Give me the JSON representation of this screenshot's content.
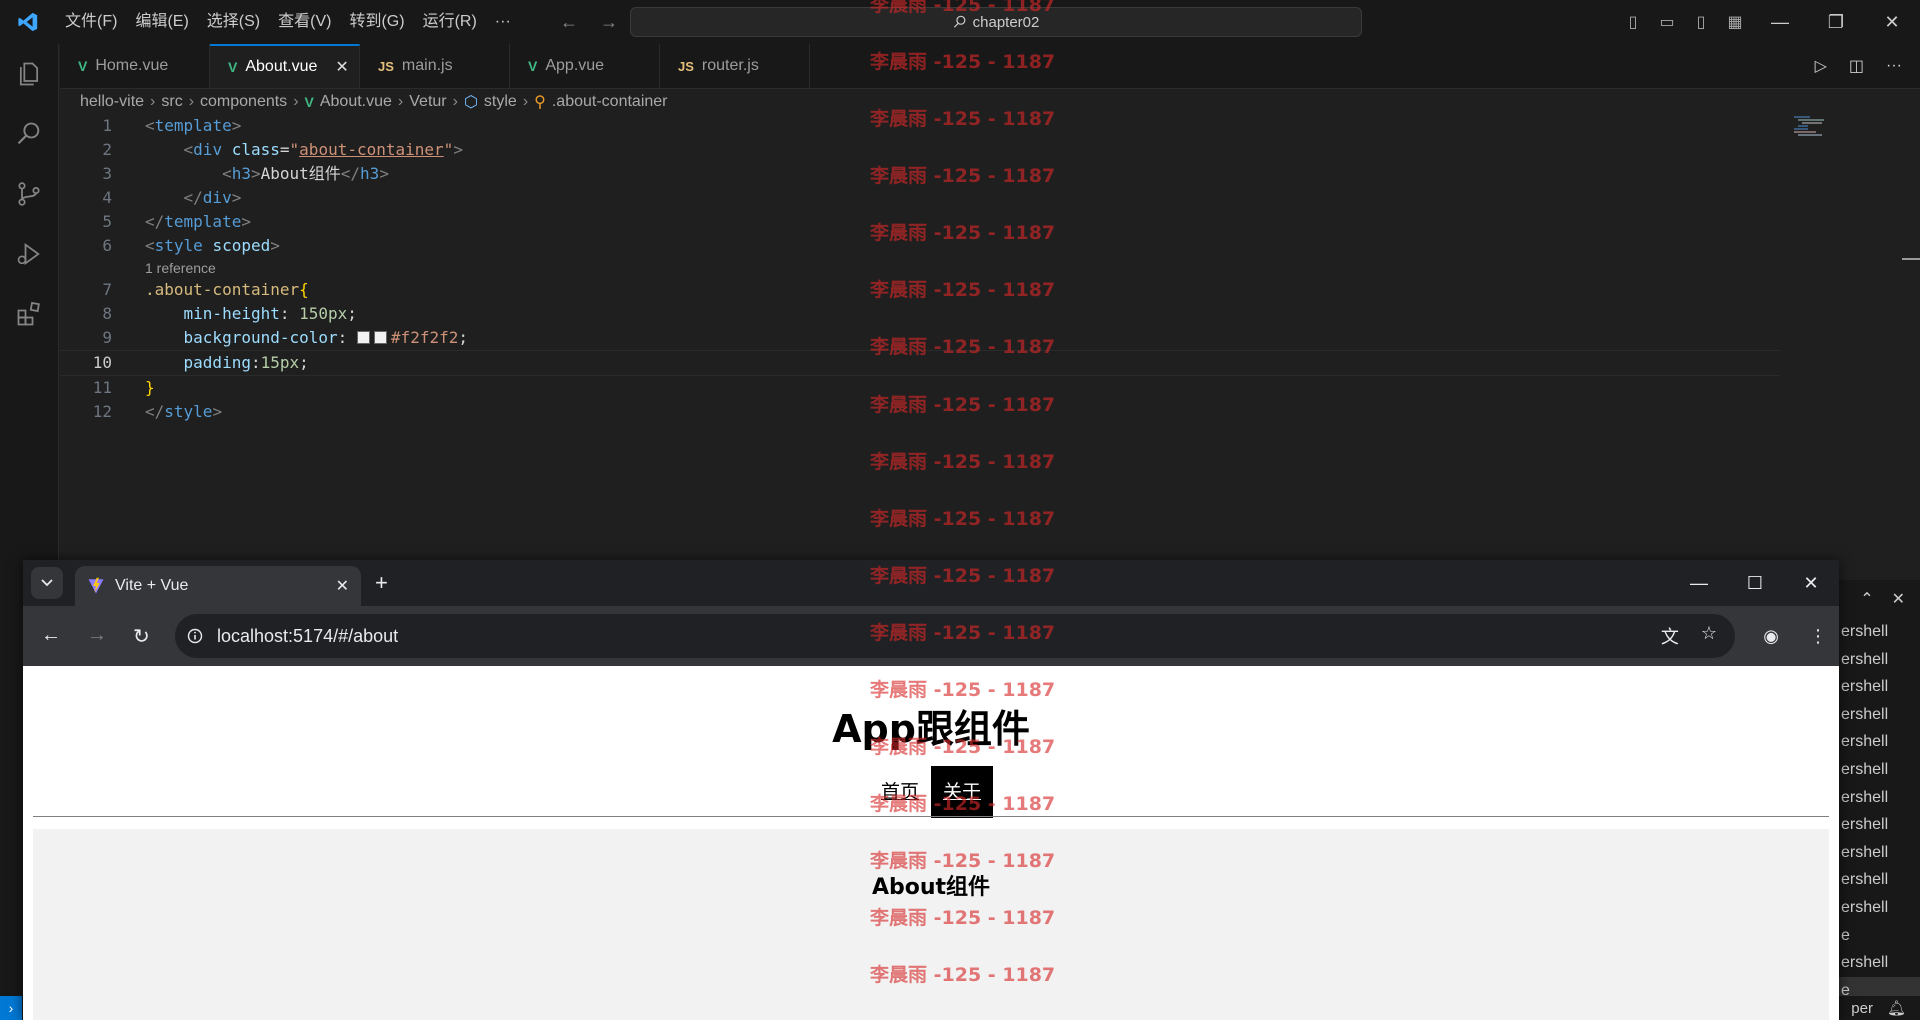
{
  "vscode": {
    "menu": [
      "文件(F)",
      "编辑(E)",
      "选择(S)",
      "查看(V)",
      "转到(G)",
      "运行(R)",
      "···"
    ],
    "search_text": "chapter02",
    "tabs": [
      {
        "label": "Home.vue",
        "kind": "vue"
      },
      {
        "label": "About.vue",
        "kind": "vue",
        "active": true
      },
      {
        "label": "main.js",
        "kind": "js"
      },
      {
        "label": "App.vue",
        "kind": "vue"
      },
      {
        "label": "router.js",
        "kind": "js"
      }
    ],
    "js_glyph": "JS",
    "breadcrumb": [
      "hello-vite",
      "src",
      "components",
      "About.vue",
      "Vetur",
      "style",
      ".about-container"
    ],
    "codelens": "1 reference",
    "code": {
      "l1": {
        "n": "1",
        "tag": "template"
      },
      "l2": {
        "n": "2",
        "tag": "div",
        "attr": "class",
        "value": "about-container"
      },
      "l3": {
        "n": "3",
        "tag": "h3",
        "text": "About组件"
      },
      "l4": {
        "n": "4",
        "tag": "div"
      },
      "l5": {
        "n": "5",
        "tag": "template"
      },
      "l6": {
        "n": "6",
        "tag": "style",
        "attr": "scoped"
      },
      "l7": {
        "n": "7",
        "selector": ".about-container"
      },
      "l8": {
        "n": "8",
        "prop": "min-height",
        "value": "150px"
      },
      "l9": {
        "n": "9",
        "prop": "background-color",
        "value": "#f2f2f2"
      },
      "l10": {
        "n": "10",
        "prop": "padding",
        "value": "15px"
      },
      "l11": {
        "n": "11"
      },
      "l12": {
        "n": "12",
        "tag": "style"
      }
    },
    "terminal_items": [
      "ershell",
      "ershell",
      "ershell",
      "ershell",
      "ershell",
      "ershell",
      "ershell",
      "ershell",
      "ershell",
      "ershell",
      "ershell",
      "e",
      "ershell",
      "e"
    ],
    "status_right": "per",
    "remote_glyph": "›"
  },
  "browser": {
    "tab_title": "Vite + Vue",
    "url": "localhost:5174/#/about",
    "page": {
      "title": "App跟组件",
      "nav": [
        {
          "label": "首页",
          "active": false
        },
        {
          "label": "关于",
          "active": true
        }
      ],
      "content_heading": "About组件"
    }
  },
  "watermark": "李晨雨 -125 - 1187",
  "colors": {
    "vscode_accent": "#0078d4",
    "vue_green": "#41b883",
    "about_bg": "#f2f2f2",
    "watermark": "#d62828"
  }
}
